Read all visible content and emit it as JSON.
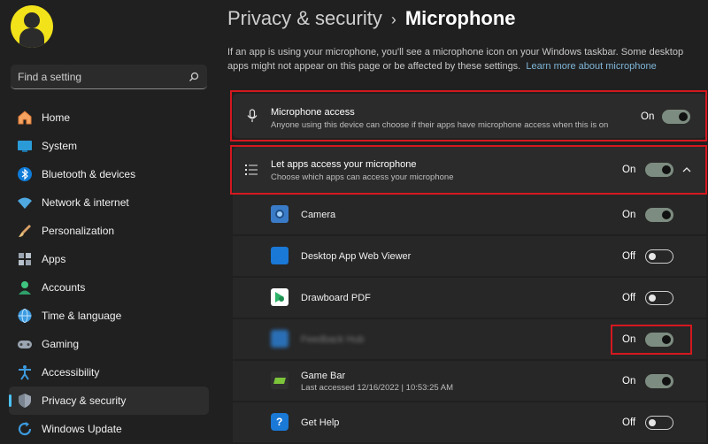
{
  "sidebar": {
    "search_placeholder": "Find a setting",
    "items": [
      {
        "label": "Home",
        "icon": "home-icon"
      },
      {
        "label": "System",
        "icon": "system-icon"
      },
      {
        "label": "Bluetooth & devices",
        "icon": "bluetooth-icon"
      },
      {
        "label": "Network & internet",
        "icon": "wifi-icon"
      },
      {
        "label": "Personalization",
        "icon": "brush-icon"
      },
      {
        "label": "Apps",
        "icon": "apps-icon"
      },
      {
        "label": "Accounts",
        "icon": "accounts-icon"
      },
      {
        "label": "Time & language",
        "icon": "globe-icon"
      },
      {
        "label": "Gaming",
        "icon": "gamepad-icon"
      },
      {
        "label": "Accessibility",
        "icon": "accessibility-icon"
      },
      {
        "label": "Privacy & security",
        "icon": "shield-icon"
      },
      {
        "label": "Windows Update",
        "icon": "update-icon"
      }
    ],
    "active_index": 10
  },
  "header": {
    "breadcrumb": "Privacy & security",
    "separator": "›",
    "page_title": "Microphone"
  },
  "description": {
    "text": "If an app is using your microphone, you'll see a microphone icon on your Windows taskbar. Some desktop apps might not appear on this page or be affected by these settings.",
    "link": "Learn more about microphone"
  },
  "microphone_access": {
    "title": "Microphone access",
    "subtitle": "Anyone using this device can choose if their apps have microphone access when this is on",
    "state": "On"
  },
  "apps_access": {
    "title": "Let apps access your microphone",
    "subtitle": "Choose which apps can access your microphone",
    "state": "On"
  },
  "apps": [
    {
      "name": "Camera",
      "sub": "",
      "state": "On"
    },
    {
      "name": "Desktop App Web Viewer",
      "sub": "",
      "state": "Off"
    },
    {
      "name": "Drawboard PDF",
      "sub": "",
      "state": "Off"
    },
    {
      "name": "Feedback Hub",
      "sub": "",
      "state": "On"
    },
    {
      "name": "Game Bar",
      "sub": "Last accessed 12/16/2022  |  10:53:25 AM",
      "state": "On"
    },
    {
      "name": "Get Help",
      "sub": "",
      "state": "Off"
    }
  ],
  "colors": {
    "accent": "#4cc2ff",
    "highlight_box": "#d4181f"
  }
}
